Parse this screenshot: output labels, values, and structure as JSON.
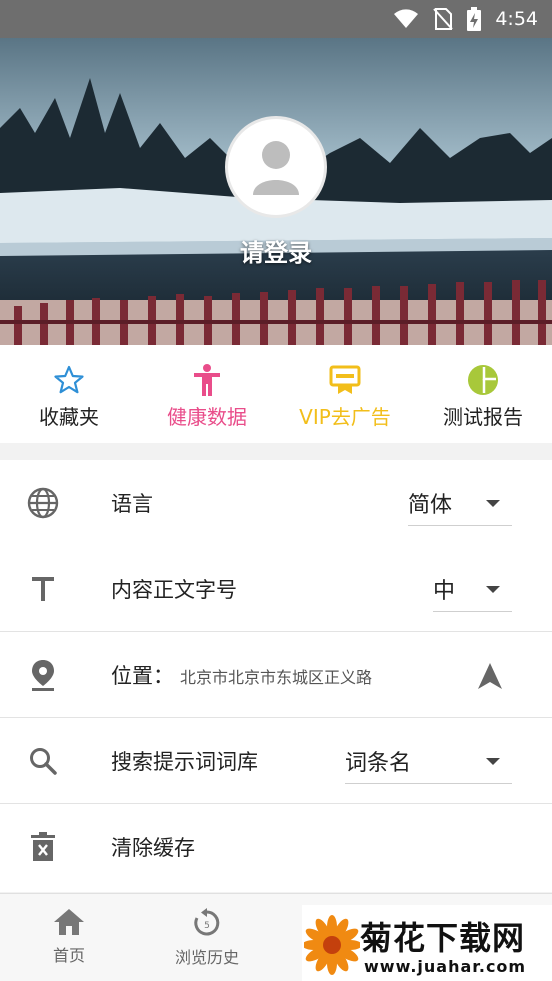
{
  "status_bar": {
    "time": "4:54"
  },
  "header": {
    "login_label": "请登录"
  },
  "quick_actions": [
    {
      "label": "收藏夹",
      "icon": "star-icon",
      "color": "#2e8fd6"
    },
    {
      "label": "健康数据",
      "icon": "person-icon",
      "color": "#e94d8a"
    },
    {
      "label": "VIP去广告",
      "icon": "vip-badge-icon",
      "color": "#f2be1a"
    },
    {
      "label": "测试报告",
      "icon": "pie-chart-icon",
      "color": "#a8c83a"
    }
  ],
  "settings": {
    "language": {
      "label": "语言",
      "value": "简体"
    },
    "font_size": {
      "label": "内容正文字号",
      "value": "中"
    },
    "location": {
      "label": "位置：",
      "value": "北京市北京市东城区正义路"
    },
    "search_dict": {
      "label": "搜索提示词词库",
      "value": "词条名"
    },
    "clear_cache": {
      "label": "清除缓存"
    }
  },
  "bottom_nav": [
    {
      "label": "首页",
      "icon": "home-icon"
    },
    {
      "label": "浏览历史",
      "icon": "history-icon",
      "badge": "5"
    }
  ],
  "watermark": {
    "brand": "菊花下载网",
    "url": "www.juahar.com"
  }
}
